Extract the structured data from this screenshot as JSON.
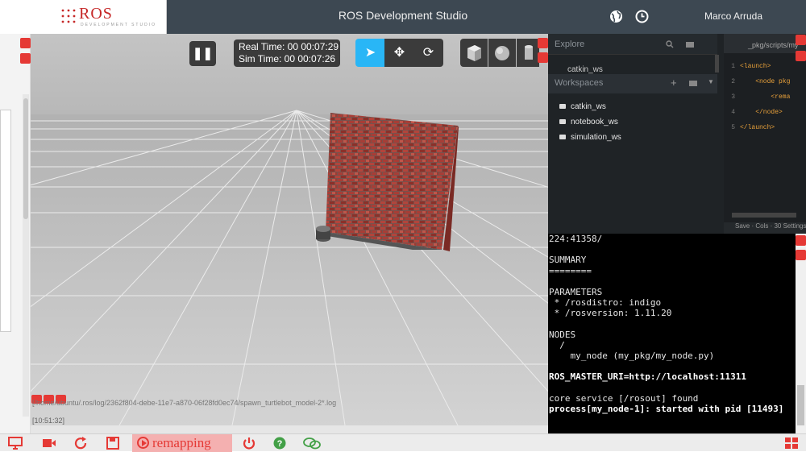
{
  "app": {
    "title": "ROS Development Studio",
    "logo_text": "ROS",
    "logo_sub": "DEVELOPMENT STUDIO",
    "user": "Marco Arruda"
  },
  "sim": {
    "real_time": "Real Time: 00 00:07:29",
    "sim_time": "Sim Time: 00 00:07:26",
    "log_line": "[/home/ubuntu/.ros/log/2362f804-debe-11e7-a870-06f28fd0ec74/spawn_turtlebot_model-2*.log",
    "log_time": "[10:51:32]"
  },
  "ide": {
    "explore_title": "Explore",
    "workspaces_title": "Workspaces",
    "catkin_top": "catkin_ws",
    "workspaces": [
      "catkin_ws",
      "notebook_ws",
      "simulation_ws"
    ],
    "editor_path": "_pkg/scripts/my",
    "editor_status": "Save · Cols · 30 Settings",
    "code_lines": [
      {
        "n": "1",
        "text": "<launch>"
      },
      {
        "n": "2",
        "text": "    <node pkg"
      },
      {
        "n": "3",
        "text": "        <rema"
      },
      {
        "n": "4",
        "text": "    </node>"
      },
      {
        "n": "5",
        "text": "</launch>"
      }
    ]
  },
  "terminal": {
    "lines": [
      {
        "t": "224:41358/",
        "b": false
      },
      {
        "t": "",
        "b": false
      },
      {
        "t": "SUMMARY",
        "b": false
      },
      {
        "t": "========",
        "b": false
      },
      {
        "t": "",
        "b": false
      },
      {
        "t": "PARAMETERS",
        "b": false
      },
      {
        "t": " * /rosdistro: indigo",
        "b": false
      },
      {
        "t": " * /rosversion: 1.11.20",
        "b": false
      },
      {
        "t": "",
        "b": false
      },
      {
        "t": "NODES",
        "b": false
      },
      {
        "t": "  /",
        "b": false
      },
      {
        "t": "    my_node (my_pkg/my_node.py)",
        "b": false
      },
      {
        "t": "",
        "b": false
      },
      {
        "t": "ROS_MASTER_URI=http://localhost:11311",
        "b": true
      },
      {
        "t": "",
        "b": false
      },
      {
        "t": "core service [/rosout] found",
        "b": false
      },
      {
        "t": "process[my_node-1]: started with pid [11493]",
        "b": true
      }
    ]
  },
  "bottom": {
    "remapping_label": "remapping"
  },
  "colors": {
    "accent_red": "#e53935",
    "topbar": "#3d4852",
    "tool_active": "#29b6f6"
  }
}
